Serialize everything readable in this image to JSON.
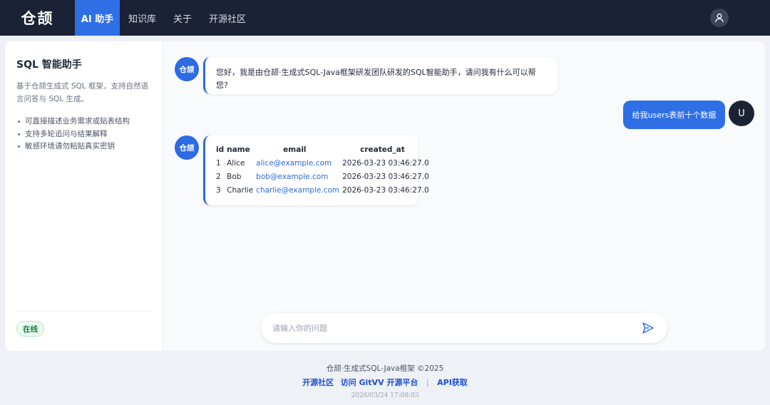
{
  "nav": {
    "logo": "仓颉",
    "items": [
      {
        "label": "AI 助手",
        "active": true
      },
      {
        "label": "知识库",
        "active": false
      },
      {
        "label": "关于",
        "active": false
      },
      {
        "label": "开源社区",
        "active": false
      }
    ],
    "user_icon": "user-icon"
  },
  "sidebar": {
    "title": "SQL 智能助手",
    "description": "基于仓颉生成式 SQL 框架，支持自然语言问答与 SQL 生成。",
    "bullets": [
      "可直接描述业务需求或贴表结构",
      "支持多轮追问与结果解释",
      "敏感环境请勿粘贴真实密钥"
    ],
    "status": "在线"
  },
  "chat": {
    "bot_avatar_label": "仓颉",
    "user_avatar_label": "U",
    "messages": [
      {
        "role": "bot",
        "text": "您好，我是由仓颉·生成式SQL-Java框架研发团队研发的SQL智能助手，请问我有什么可以帮您?"
      },
      {
        "role": "user",
        "text": "给我users表前十个数据"
      },
      {
        "role": "bot",
        "type": "table"
      }
    ],
    "table": {
      "headers": [
        "id",
        "name",
        "email",
        "created_at"
      ],
      "rows": [
        [
          "1",
          "Alice",
          "alice@example.com",
          "2026-03-23 03:46:27.0"
        ],
        [
          "2",
          "Bob",
          "bob@example.com",
          "2026-03-23 03:46:27.0"
        ],
        [
          "3",
          "Charlie",
          "charlie@example.com",
          "2026-03-23 03:46:27.0"
        ]
      ]
    },
    "input_placeholder": "请输入你的问题",
    "input_value": "",
    "send_icon": "send-icon"
  },
  "footer": {
    "copyright": "仓颉·生成式SQL-Java框架 ©2025",
    "link_community": "开源社区",
    "link_gitvv": "访问 GitVV 开源平台",
    "separator": "|",
    "link_api": "API获取",
    "timestamp": "2026/03/24 17:08:03"
  },
  "colors": {
    "nav_bg": "#1b2236",
    "accent": "#2f6fe6",
    "status_green": "#15803d"
  }
}
